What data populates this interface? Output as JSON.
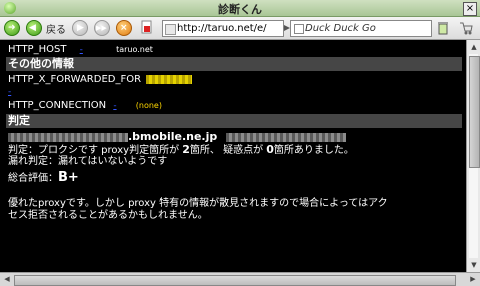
{
  "window": {
    "title": "診断くん",
    "close_glyph": "×"
  },
  "toolbar": {
    "back_label": "戻る",
    "url_value": "http://taruo.net/e/",
    "search_placeholder": "Duck Duck Go"
  },
  "content": {
    "http_host_label": "HTTP_HOST",
    "http_host_link": "-",
    "http_host_value": "taruo.net",
    "section_other": "その他の情報",
    "xff_label": "HTTP_X_FORWARDED_FOR",
    "xff_link": "-",
    "conn_label": "HTTP_CONNECTION",
    "conn_link": "-",
    "conn_value": "(none)",
    "section_judge": "判定",
    "host_suffix": ".bmobile.ne.jp",
    "judge_line_prefix": "判定：プロクシです proxy判定箇所が ",
    "judge_count": "2",
    "judge_line_mid": "箇所、 疑惑点が ",
    "doubt_count": "0",
    "judge_line_suffix": "箇所ありました。",
    "leak_line": "漏れ判定：漏れてはいないようです",
    "overall_label": "総合評価：",
    "overall_grade": "B+",
    "desc_line1": "優れたproxyです。しかし proxy 特有の情報が散見されますので場合によってはアク",
    "desc_line2": "セス拒否されることがあるかもしれません。"
  }
}
